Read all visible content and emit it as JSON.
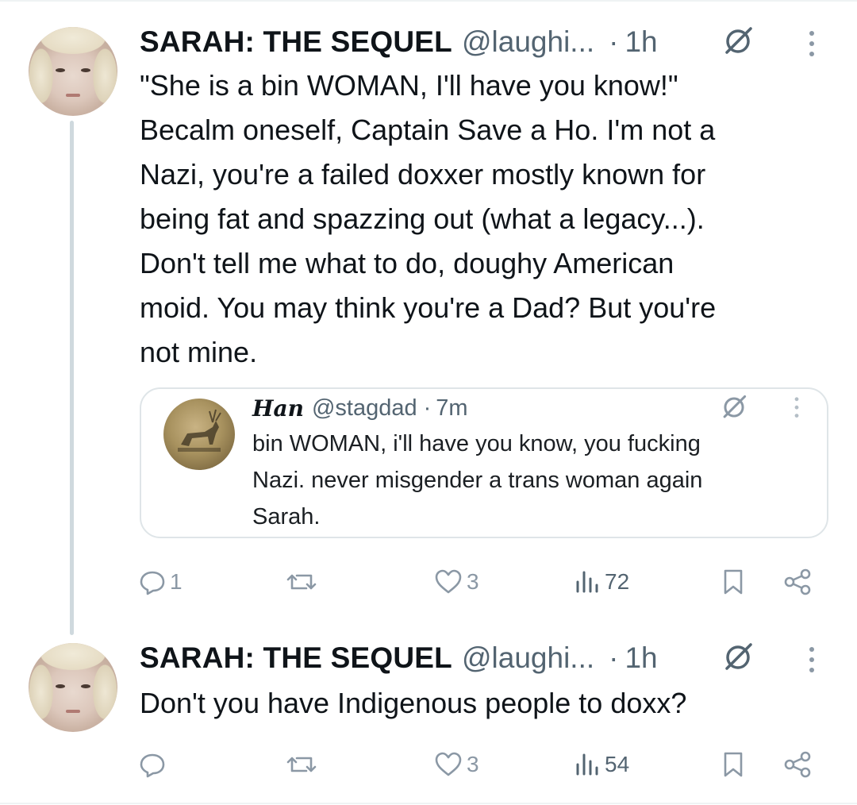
{
  "tweet1": {
    "display_name": "SARAH: THE SEQUEL",
    "handle": "@laughi...",
    "dot": "·",
    "time": "1h",
    "text": "\"She is a bin WOMAN, I'll have you know!\"\nBecalm oneself, Captain Save a Ho. I'm not a\nNazi, you're a failed doxxer mostly known for\nbeing fat and spazzing out (what a legacy...).\nDon't tell me what to do, doughy American\nmoid. You may think you're a Dad? But you're\nnot mine.",
    "quote": {
      "display_name": "Han",
      "handle": "@stagdad",
      "dot": "·",
      "time": "7m",
      "text": "bin WOMAN, i'll have you know, you fucking\nNazi. never misgender a trans woman again\nSarah."
    },
    "actions": {
      "replies": "1",
      "retweets": "",
      "likes": "3",
      "views": "72"
    }
  },
  "tweet2": {
    "display_name": "SARAH: THE SEQUEL",
    "handle": "@laughi...",
    "dot": "·",
    "time": "1h",
    "text": "Don't you have Indigenous people to doxx?",
    "actions": {
      "replies": "",
      "retweets": "",
      "likes": "3",
      "views": "54"
    }
  },
  "colors": {
    "muted": "#536471",
    "icon": "#8b98a5",
    "border": "#dfe5e8",
    "thread": "#cfd9de"
  },
  "icons": [
    "reply-icon",
    "retweet-icon",
    "like-icon",
    "views-icon",
    "bookmark-icon",
    "share-icon",
    "grok-icon",
    "more-icon"
  ]
}
